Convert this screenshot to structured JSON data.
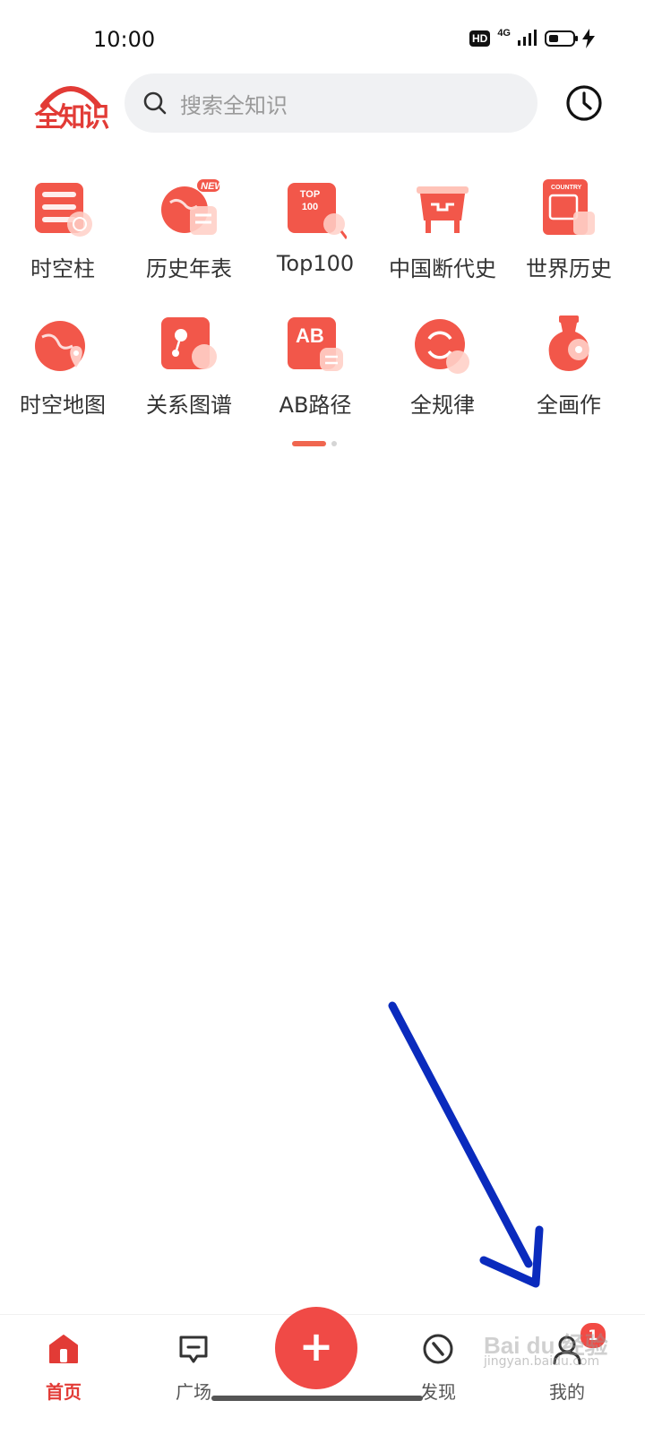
{
  "status_bar": {
    "time": "10:00",
    "hd": "HD",
    "network": "4G"
  },
  "header": {
    "logo_text": "全知识",
    "search_placeholder": "搜索全知识"
  },
  "grid": {
    "items": [
      {
        "label": "时空柱",
        "icon": "timeline-pillar-icon"
      },
      {
        "label": "历史年表",
        "icon": "history-timeline-icon",
        "badge": "NEW"
      },
      {
        "label": "Top100",
        "icon": "top100-icon",
        "icon_text": "TOP 100"
      },
      {
        "label": "中国断代史",
        "icon": "ancient-vessel-icon"
      },
      {
        "label": "世界历史",
        "icon": "country-book-icon",
        "icon_text": "COUNTRY"
      },
      {
        "label": "时空地图",
        "icon": "globe-map-icon"
      },
      {
        "label": "关系图谱",
        "icon": "relation-graph-icon"
      },
      {
        "label": "AB路径",
        "icon": "ab-path-icon",
        "icon_text": "AB"
      },
      {
        "label": "全规律",
        "icon": "cycle-law-icon"
      },
      {
        "label": "全画作",
        "icon": "vase-icon"
      }
    ]
  },
  "bottom_nav": {
    "items": [
      {
        "label": "首页",
        "active": true
      },
      {
        "label": "广场",
        "active": false
      },
      {
        "label": "发现",
        "active": false
      },
      {
        "label": "我的",
        "active": false,
        "badge": "1"
      }
    ],
    "fab_label": "+"
  },
  "watermark": {
    "main": "Bai du 经验",
    "sub": "jingyan.baidu.com"
  },
  "colors": {
    "brand_red": "#e23b36",
    "annotation_arrow": "#0a2bbd"
  }
}
